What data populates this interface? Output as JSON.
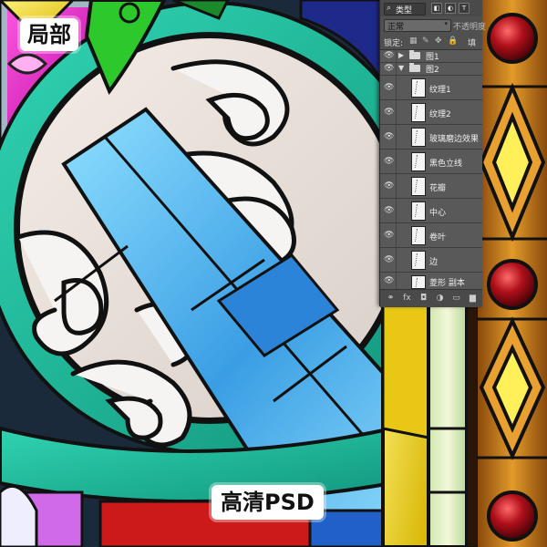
{
  "labels": {
    "detail_badge": "局部",
    "hd_badge": "高清PSD"
  },
  "layers_panel": {
    "filter_label": "类型",
    "toolbar_icons": [
      "image-filter-icon",
      "adjustment-filter-icon",
      "type-filter-icon"
    ],
    "toolbar_glyphs": [
      "◧",
      "◐",
      "T"
    ],
    "blend_mode": "正常",
    "opacity_label": "不透明度",
    "lock_label": "锁定:",
    "lock_glyphs": [
      "▦",
      "✎",
      "✥",
      "🔒"
    ],
    "fill_label": "填充",
    "groups": [
      {
        "name": "图1",
        "expanded": false,
        "arrow": "▶"
      },
      {
        "name": "图2",
        "expanded": true,
        "arrow": "▼"
      }
    ],
    "eye_glyph": "👁",
    "layers": [
      "纹理1",
      "纹理2",
      "玻璃磨边效果",
      "黑色立线",
      "花瓣",
      "中心",
      "卷叶",
      "边",
      "菱形 副本"
    ],
    "bottom_glyphs": [
      "⚭",
      "fx",
      "◘",
      "◑",
      "▭",
      "▆"
    ]
  },
  "colors": {
    "panel_bg": "#535353",
    "teal_glass": "#1fb89a",
    "blue_glass": "#3aa0e0",
    "amber_glass": "#c27a1c",
    "red_glass": "#c21a2a"
  }
}
